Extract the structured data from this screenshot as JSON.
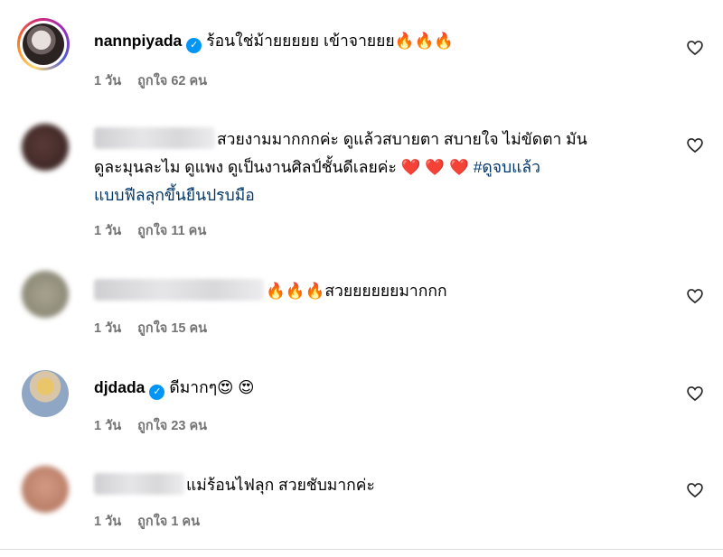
{
  "comments": [
    {
      "username": "nannpiyada",
      "verified": true,
      "text": "ร้อนใช่ม้ายยยยย เข้าจายยย🔥🔥🔥",
      "time": "1 วัน",
      "likes": "ถูกใจ 62 คน"
    },
    {
      "username": "",
      "verified": false,
      "line1": "สวยงามมากกกค่ะ ดูแล้วสบายตา สบายใจ ไม่ขัดตา มัน",
      "line2_text": "ดูละมุนละไม ดูแพง ดูเป็นงานศิลป์ชั้นดีเลยค่ะ ❤️ ❤️ ❤️ ",
      "line2_hashtag": "#ดูจบแล้ว",
      "line3_hashtag": "แบบฟีลลุกขึ้นยืนปรบมือ",
      "time": "1 วัน",
      "likes": "ถูกใจ 11 คน"
    },
    {
      "username": "",
      "verified": false,
      "text": "🔥🔥🔥สวยยยยยยมากกก",
      "time": "1 วัน",
      "likes": "ถูกใจ 15 คน"
    },
    {
      "username": "djdada",
      "verified": true,
      "text": "ดีมากๆ😍 😍",
      "time": "1 วัน",
      "likes": "ถูกใจ 23 คน"
    },
    {
      "username": "",
      "verified": false,
      "text": "แม่ร้อนไฟลุก สวยชับมากค่ะ",
      "time": "1 วัน",
      "likes": "ถูกใจ 1 คน"
    }
  ],
  "icons": {
    "like": "heart-outline-icon",
    "verified": "verified-badge-icon"
  },
  "colors": {
    "verified": "#0095f6",
    "hashtag": "#00376b",
    "meta": "#737373"
  }
}
